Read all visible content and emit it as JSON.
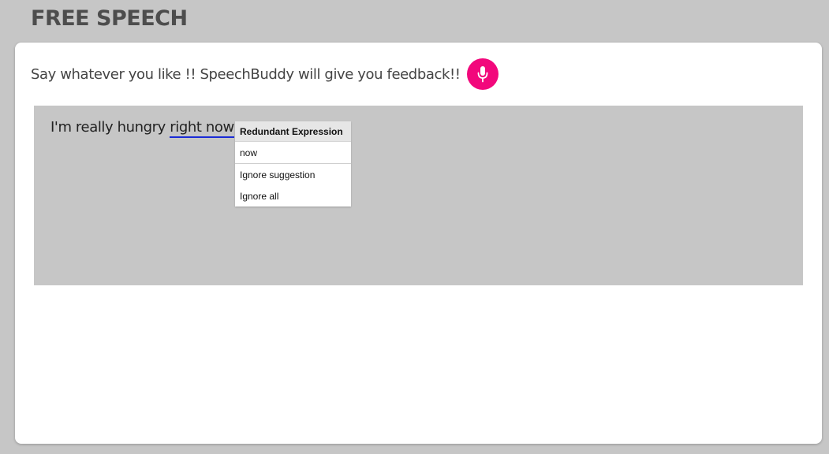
{
  "page": {
    "title": "FREE SPEECH"
  },
  "prompt": {
    "text": "Say whatever you like !! SpeechBuddy will give you feedback!!",
    "mic_icon": "microphone-icon",
    "mic_color": "#f2087c"
  },
  "speech": {
    "text_before": "I'm really hungry ",
    "flagged_text": "right now"
  },
  "suggestion_popup": {
    "title": "Redundant Expression",
    "suggestion": "now",
    "ignore_suggestion_label": "Ignore suggestion",
    "ignore_all_label": "Ignore all"
  }
}
